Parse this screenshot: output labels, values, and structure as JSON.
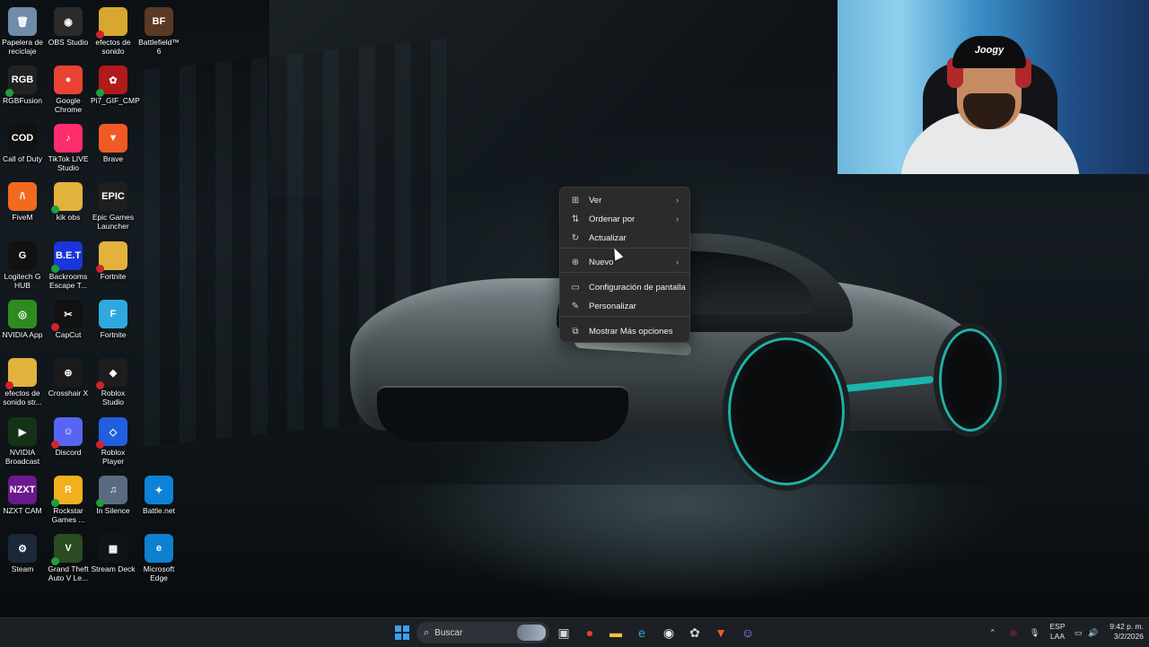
{
  "desktop": {
    "icons": [
      {
        "label": "Papelera de reciclaje",
        "icon": "recycle-bin-icon",
        "color": "#6f8ca8",
        "symbol": "🗑",
        "status": ""
      },
      {
        "label": "OBS Studio",
        "icon": "obs-icon",
        "color": "#2a2a2a",
        "symbol": "◉",
        "status": ""
      },
      {
        "label": "efectos de sonido",
        "icon": "folder-icon",
        "color": "#d8a730",
        "symbol": "",
        "status": "err"
      },
      {
        "label": "Battlefield™ 6",
        "icon": "battlefield-icon",
        "color": "#5b3a24",
        "symbol": "BF",
        "status": ""
      },
      {
        "label": "RGBFusion",
        "icon": "rgbfusion-icon",
        "color": "#222",
        "symbol": "RGB",
        "status": "ok"
      },
      {
        "label": "Google Chrome",
        "icon": "chrome-icon",
        "color": "#e94235",
        "symbol": "●",
        "status": ""
      },
      {
        "label": "Pi7_GIF_CMP",
        "icon": "gif-icon",
        "color": "#b01a1a",
        "symbol": "✿",
        "status": "ok"
      },
      {
        "label": "Call of Duty",
        "icon": "call-of-duty-icon",
        "color": "#111",
        "symbol": "COD",
        "status": ""
      },
      {
        "label": "TikTok LIVE Studio",
        "icon": "tiktok-icon",
        "color": "#ff2c6c",
        "symbol": "♪",
        "status": ""
      },
      {
        "label": "Brave",
        "icon": "brave-icon",
        "color": "#f05a24",
        "symbol": "▼",
        "status": ""
      },
      {
        "label": "FiveM",
        "icon": "fivem-icon",
        "color": "#f26a1b",
        "symbol": "/\\",
        "status": ""
      },
      {
        "label": "kik obs",
        "icon": "folder-icon",
        "color": "#e2b23c",
        "symbol": "",
        "status": "ok"
      },
      {
        "label": "Epic Games Launcher",
        "icon": "epic-games-icon",
        "color": "#1f1f1f",
        "symbol": "EPIC",
        "status": ""
      },
      {
        "label": "Logitech G HUB",
        "icon": "logitech-icon",
        "color": "#111",
        "symbol": "G",
        "status": ""
      },
      {
        "label": "Backrooms Escape T...",
        "icon": "backrooms-icon",
        "color": "#1a35d8",
        "symbol": "B.E.T",
        "status": "ok"
      },
      {
        "label": "Fortnite",
        "icon": "folder-icon",
        "color": "#e2b23c",
        "symbol": "",
        "status": "err"
      },
      {
        "label": "NVIDIA App",
        "icon": "nvidia-icon",
        "color": "#2e8b1f",
        "symbol": "◎",
        "status": ""
      },
      {
        "label": "CapCut",
        "icon": "capcut-icon",
        "color": "#111",
        "symbol": "✂",
        "status": "err"
      },
      {
        "label": "Fortnite",
        "icon": "fortnite-icon",
        "color": "#2fa8e0",
        "symbol": "F",
        "status": ""
      },
      {
        "label": "efectos de sonido str...",
        "icon": "folder-icon",
        "color": "#e2b23c",
        "symbol": "",
        "status": "err"
      },
      {
        "label": "Crosshair X",
        "icon": "crosshair-icon",
        "color": "#1a1a1a",
        "symbol": "⊕",
        "status": ""
      },
      {
        "label": "Roblox Studio",
        "icon": "roblox-studio-icon",
        "color": "#1d1d1d",
        "symbol": "◆",
        "status": "err"
      },
      {
        "label": "NVIDIA Broadcast",
        "icon": "nvidia-broadcast-icon",
        "color": "#143316",
        "symbol": "▶",
        "status": ""
      },
      {
        "label": "Discord",
        "icon": "discord-icon",
        "color": "#5865f2",
        "symbol": "☺",
        "status": "err"
      },
      {
        "label": "Roblox Player",
        "icon": "roblox-player-icon",
        "color": "#1f5fe0",
        "symbol": "◇",
        "status": "err"
      },
      {
        "label": "NZXT CAM",
        "icon": "nzxt-icon",
        "color": "#6a1a8c",
        "symbol": "NZXT",
        "status": ""
      },
      {
        "label": "Rockstar Games ...",
        "icon": "rockstar-icon",
        "color": "#f2b01e",
        "symbol": "R",
        "status": "ok"
      },
      {
        "label": "In Silence",
        "icon": "in-silence-icon",
        "color": "#5a6a80",
        "symbol": "♫",
        "status": "ok"
      },
      {
        "label": "Battle.net",
        "icon": "battlenet-icon",
        "color": "#0e82d8",
        "symbol": "✦",
        "status": ""
      },
      {
        "label": "Steam",
        "icon": "steam-icon",
        "color": "#1b2838",
        "symbol": "⚙",
        "status": ""
      },
      {
        "label": "Grand Theft Auto V Le...",
        "icon": "gta-icon",
        "color": "#2b4b22",
        "symbol": "V",
        "status": "ok"
      },
      {
        "label": "Stream Deck",
        "icon": "stream-deck-icon",
        "color": "#101418",
        "symbol": "▦",
        "status": ""
      },
      {
        "label": "Microsoft Edge",
        "icon": "edge-icon",
        "color": "#0f7fd0",
        "symbol": "e",
        "status": ""
      }
    ]
  },
  "webcam": {
    "hat_text": "Joogy"
  },
  "context_menu": {
    "items": [
      {
        "label": "Ver",
        "icon": "grid-icon",
        "symbol": "⊞",
        "submenu": true
      },
      {
        "label": "Ordenar por",
        "icon": "sort-icon",
        "symbol": "⇅",
        "submenu": true
      },
      {
        "label": "Actualizar",
        "icon": "refresh-icon",
        "symbol": "↻",
        "submenu": false
      },
      {
        "label": "Nuevo",
        "icon": "new-icon",
        "symbol": "⊕",
        "submenu": true
      },
      {
        "label": "Configuración de pantalla",
        "icon": "display-icon",
        "symbol": "▭",
        "submenu": false
      },
      {
        "label": "Personalizar",
        "icon": "brush-icon",
        "symbol": "✎",
        "submenu": false
      },
      {
        "label": "Mostrar Más opciones",
        "icon": "more-options-icon",
        "symbol": "⧉",
        "submenu": false
      }
    ],
    "chevron": "›"
  },
  "taskbar": {
    "search_placeholder": "Buscar",
    "apps": [
      {
        "icon": "task-view-icon",
        "symbol": "▣",
        "color": "#d9d9d9"
      },
      {
        "icon": "chrome-icon",
        "symbol": "●",
        "color": "#e94235"
      },
      {
        "icon": "file-explorer-icon",
        "symbol": "▬",
        "color": "#f2c13b"
      },
      {
        "icon": "edge-icon",
        "symbol": "e",
        "color": "#2fa3e8"
      },
      {
        "icon": "obs-icon",
        "symbol": "◉",
        "color": "#eaeaea"
      },
      {
        "icon": "gif-icon",
        "symbol": "✿",
        "color": "#cfcfcf"
      },
      {
        "icon": "brave-icon",
        "symbol": "▼",
        "color": "#f05a24"
      },
      {
        "icon": "discord-icon",
        "symbol": "☺",
        "color": "#8b95ff"
      }
    ],
    "tray": {
      "chevron": "⌃",
      "language_line1": "ESP",
      "language_line2": "LAA",
      "time": "9:42 p. m.",
      "date": "3/2/2026"
    }
  }
}
